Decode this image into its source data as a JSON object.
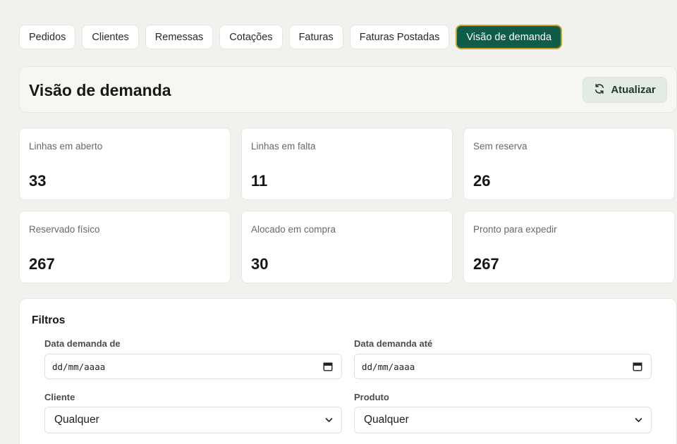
{
  "tabs": [
    {
      "label": "Pedidos"
    },
    {
      "label": "Clientes"
    },
    {
      "label": "Remessas"
    },
    {
      "label": "Cotações"
    },
    {
      "label": "Faturas"
    },
    {
      "label": "Faturas Postadas"
    },
    {
      "label": "Visão de demanda"
    }
  ],
  "active_tab": "Visão de demanda",
  "header": {
    "title": "Visão de demanda",
    "refresh_label": "Atualizar",
    "refresh_icon": "refresh-icon"
  },
  "stats": [
    {
      "label": "Linhas em aberto",
      "value": "33"
    },
    {
      "label": "Linhas em falta",
      "value": "11"
    },
    {
      "label": "Sem reserva",
      "value": "26"
    },
    {
      "label": "Reservado físico",
      "value": "267"
    },
    {
      "label": "Alocado em compra",
      "value": "30"
    },
    {
      "label": "Pronto para expedir",
      "value": "267"
    }
  ],
  "filters": {
    "title": "Filtros",
    "date_from": {
      "label": "Data demanda de",
      "placeholder": "dd/mm/aaaa"
    },
    "date_to": {
      "label": "Data demanda até",
      "placeholder": "dd/mm/aaaa"
    },
    "client": {
      "label": "Cliente",
      "value": "Qualquer"
    },
    "product": {
      "label": "Produto",
      "value": "Qualquer"
    }
  },
  "colors": {
    "accent": "#0f5c49",
    "active_tab_border": "#c9a227",
    "background": "#f1f2ed"
  }
}
